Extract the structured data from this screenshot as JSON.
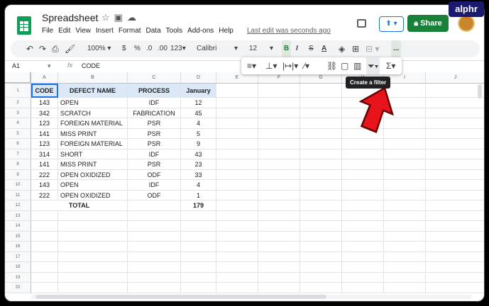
{
  "watermark": "alphr",
  "doc": {
    "title": "Spreadsheet",
    "last_edit": "Last edit was seconds ago"
  },
  "menu": [
    "File",
    "Edit",
    "View",
    "Insert",
    "Format",
    "Data",
    "Tools",
    "Add-ons",
    "Help"
  ],
  "share_label": "Share",
  "toolbar": {
    "zoom": "100%",
    "currency": "$",
    "percent": "%",
    "dec_less": ".0",
    "dec_more": ".00",
    "number_format": "123",
    "font": "Calibri",
    "font_size": "12",
    "bold": "B",
    "italic": "I",
    "strike": "S",
    "text_color": "A",
    "more": "..."
  },
  "tooltip": "Create a filter",
  "formula_bar": {
    "name_box": "A1",
    "fx": "fx",
    "value": "CODE"
  },
  "columns": [
    "A",
    "B",
    "C",
    "D",
    "E",
    "F",
    "G",
    "H",
    "I",
    "J"
  ],
  "rows": [
    "1",
    "2",
    "3",
    "4",
    "5",
    "6",
    "7",
    "8",
    "9",
    "10",
    "11",
    "12",
    "13",
    "14",
    "15",
    "16",
    "17",
    "18",
    "19",
    "20"
  ],
  "table": {
    "headers": [
      "CODE",
      "DEFECT NAME",
      "PROCESS",
      "January"
    ],
    "rows": [
      [
        "143",
        "OPEN",
        "IDF",
        "12"
      ],
      [
        "342",
        "SCRATCH",
        "FABRICATION",
        "45"
      ],
      [
        "123",
        "FOREIGN MATERIAL",
        "PSR",
        "4"
      ],
      [
        "141",
        "MISS PRINT",
        "PSR",
        "5"
      ],
      [
        "123",
        "FOREIGN MATERIAL",
        "PSR",
        "9"
      ],
      [
        "314",
        "SHORT",
        "IDF",
        "43"
      ],
      [
        "141",
        "MISS PRINT",
        "PSR",
        "23"
      ],
      [
        "222",
        "OPEN OXIDIZED",
        "ODF",
        "33"
      ],
      [
        "143",
        "OPEN",
        "IDF",
        "4"
      ],
      [
        "222",
        "OPEN OXIDIZED",
        "ODF",
        "1"
      ]
    ],
    "total_label": "TOTAL",
    "total_value": "179"
  },
  "colors": {
    "share": "#188038",
    "header_fill": "#dbe8f7",
    "arrow": "#e8141b",
    "selection": "#1a73e8"
  }
}
